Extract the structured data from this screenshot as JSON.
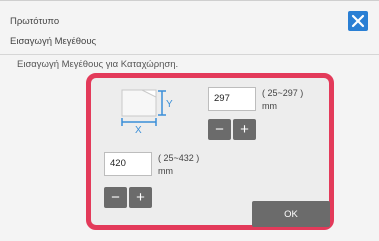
{
  "header": {
    "title": "Πρωτότυπο",
    "subtitle": "Εισαγωγή Μεγέθους",
    "close_icon": "close-icon"
  },
  "instruction": "Εισαγωγή Μεγέθους για Καταχώρηση.",
  "paper_icon": {
    "x_label": "X",
    "y_label": "Y"
  },
  "y_size": {
    "value": "297",
    "range": "( 25~297 )",
    "unit": "mm",
    "minus": "−",
    "plus": "+"
  },
  "x_size": {
    "value": "420",
    "range": "( 25~432 )",
    "unit": "mm",
    "minus": "−",
    "plus": "+"
  },
  "ok_label": "OK",
  "colors": {
    "accent": "#2a7fd4",
    "highlight_border": "#e33a5a",
    "button_gray": "#6b6b6b"
  }
}
